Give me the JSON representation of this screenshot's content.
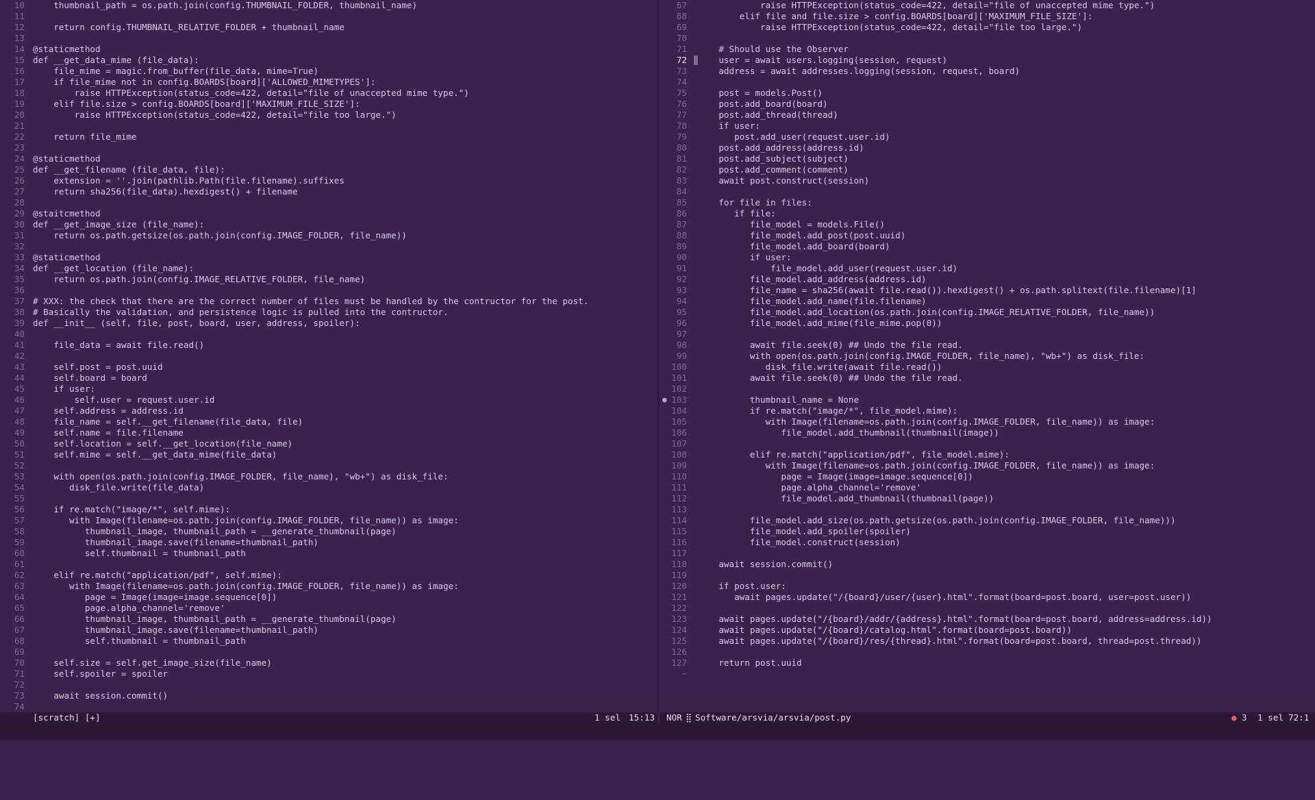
{
  "editor": {
    "left_pane": {
      "lines": [
        {
          "n": "10",
          "code": "    thumbnail_path = os.path.join(config.THUMBNAIL_FOLDER, thumbnail_name)"
        },
        {
          "n": "11",
          "code": ""
        },
        {
          "n": "12",
          "code": "    return config.THUMBNAIL_RELATIVE_FOLDER + thumbnail_name"
        },
        {
          "n": "13",
          "code": ""
        },
        {
          "n": "14",
          "code": "@staticmethod"
        },
        {
          "n": "15",
          "code": "def __get_data_mime (file_data):"
        },
        {
          "n": "16",
          "code": "    file_mime = magic.from_buffer(file_data, mime=True)"
        },
        {
          "n": "17",
          "code": "    if file_mime not in config.BOARDS[board]['ALLOWED_MIMETYPES']:"
        },
        {
          "n": "18",
          "code": "        raise HTTPException(status_code=422, detail=\"file of unaccepted mime type.\")"
        },
        {
          "n": "19",
          "code": "    elif file.size > config.BOARDS[board]['MAXIMUM_FILE_SIZE']:"
        },
        {
          "n": "20",
          "code": "        raise HTTPException(status_code=422, detail=\"file too large.\")"
        },
        {
          "n": "21",
          "code": ""
        },
        {
          "n": "22",
          "code": "    return file_mime"
        },
        {
          "n": "23",
          "code": ""
        },
        {
          "n": "24",
          "code": "@staticmethod"
        },
        {
          "n": "25",
          "code": "def __get_filename (file_data, file):"
        },
        {
          "n": "26",
          "code": "    extension = ''.join(pathlib.Path(file.filename).suffixes"
        },
        {
          "n": "27",
          "code": "    return sha256(file_data).hexdigest() + filename"
        },
        {
          "n": "28",
          "code": ""
        },
        {
          "n": "29",
          "code": "@staitcmethod"
        },
        {
          "n": "30",
          "code": "def __get_image_size (file_name):"
        },
        {
          "n": "31",
          "code": "    return os.path.getsize(os.path.join(config.IMAGE_FOLDER, file_name))"
        },
        {
          "n": "32",
          "code": ""
        },
        {
          "n": "33",
          "code": "@staticmethod"
        },
        {
          "n": "34",
          "code": "def __get_location (file_name):"
        },
        {
          "n": "35",
          "code": "    return os.path.join(config.IMAGE_RELATIVE_FOLDER, file_name)"
        },
        {
          "n": "36",
          "code": ""
        },
        {
          "n": "37",
          "code": "# XXX: the check that there are the correct number of files must be handled by the contructor for the post."
        },
        {
          "n": "38",
          "code": "# Basically the validation, and persistence logic is pulled into the contructor."
        },
        {
          "n": "39",
          "code": "def __init__ (self, file, post, board, user, address, spoiler):"
        },
        {
          "n": "40",
          "code": ""
        },
        {
          "n": "41",
          "code": "    file_data = await file.read()"
        },
        {
          "n": "42",
          "code": ""
        },
        {
          "n": "43",
          "code": "    self.post = post.uuid"
        },
        {
          "n": "44",
          "code": "    self.board = board"
        },
        {
          "n": "45",
          "code": "    if user:"
        },
        {
          "n": "46",
          "code": "        self.user = request.user.id"
        },
        {
          "n": "47",
          "code": "    self.address = address.id"
        },
        {
          "n": "48",
          "code": "    file_name = self.__get_filename(file_data, file)"
        },
        {
          "n": "49",
          "code": "    self.name = file.filename"
        },
        {
          "n": "50",
          "code": "    self.location = self.__get_location(file_name)"
        },
        {
          "n": "51",
          "code": "    self.mime = self.__get_data_mime(file_data)"
        },
        {
          "n": "52",
          "code": ""
        },
        {
          "n": "53",
          "code": "    with open(os.path.join(config.IMAGE_FOLDER, file_name), \"wb+\") as disk_file:"
        },
        {
          "n": "54",
          "code": "       disk_file.write(file_data)"
        },
        {
          "n": "55",
          "code": ""
        },
        {
          "n": "56",
          "code": "    if re.match(\"image/*\", self.mime):"
        },
        {
          "n": "57",
          "code": "       with Image(filename=os.path.join(config.IMAGE_FOLDER, file_name)) as image:"
        },
        {
          "n": "58",
          "code": "          thumbnail_image, thumbnail_path = __generate_thumbnail(page)"
        },
        {
          "n": "59",
          "code": "          thumbnail_image.save(filename=thumbnail_path)"
        },
        {
          "n": "60",
          "code": "          self.thumbnail = thumbnail_path"
        },
        {
          "n": "61",
          "code": ""
        },
        {
          "n": "62",
          "code": "    elif re.match(\"application/pdf\", self.mime):"
        },
        {
          "n": "63",
          "code": "       with Image(filename=os.path.join(config.IMAGE_FOLDER, file_name)) as image:"
        },
        {
          "n": "64",
          "code": "          page = Image(image=image.sequence[0])"
        },
        {
          "n": "65",
          "code": "          page.alpha_channel='remove'"
        },
        {
          "n": "66",
          "code": "          thumbnail_image, thumbnail_path = __generate_thumbnail(page)"
        },
        {
          "n": "67",
          "code": "          thumbnail_image.save(filename=thumbnail_path)"
        },
        {
          "n": "68",
          "code": "          self.thumbnail = thumbnail_path"
        },
        {
          "n": "69",
          "code": ""
        },
        {
          "n": "70",
          "code": "    self.size = self.get_image_size(file_name)"
        },
        {
          "n": "71",
          "code": "    self.spoiler = spoiler"
        },
        {
          "n": "72",
          "code": ""
        },
        {
          "n": "73",
          "code": "    await session.commit()"
        },
        {
          "n": "74",
          "code": ""
        }
      ]
    },
    "right_pane": {
      "lines": [
        {
          "n": "67",
          "code": "            raise HTTPException(status_code=422, detail=\"file of unaccepted mime type.\")"
        },
        {
          "n": "68",
          "code": "        elif file and file.size > config.BOARDS[board]['MAXIMUM_FILE_SIZE']:"
        },
        {
          "n": "69",
          "code": "            raise HTTPException(status_code=422, detail=\"file too large.\")"
        },
        {
          "n": "70",
          "code": ""
        },
        {
          "n": "71",
          "code": "    # Should use the Observer"
        },
        {
          "n": "72",
          "code": "    user = await users.logging(session, request)"
        },
        {
          "n": "73",
          "code": "    address = await addresses.logging(session, request, board)"
        },
        {
          "n": "74",
          "code": ""
        },
        {
          "n": "75",
          "code": "    post = models.Post()"
        },
        {
          "n": "76",
          "code": "    post.add_board(board)"
        },
        {
          "n": "77",
          "code": "    post.add_thread(thread)"
        },
        {
          "n": "78",
          "code": "    if user:"
        },
        {
          "n": "79",
          "code": "       post.add_user(request.user.id)"
        },
        {
          "n": "80",
          "code": "    post.add_address(address.id)"
        },
        {
          "n": "81",
          "code": "    post.add_subject(subject)"
        },
        {
          "n": "82",
          "code": "    post.add_comment(comment)"
        },
        {
          "n": "83",
          "code": "    await post.construct(session)"
        },
        {
          "n": "84",
          "code": ""
        },
        {
          "n": "85",
          "code": "    for file in files:"
        },
        {
          "n": "86",
          "code": "       if file:"
        },
        {
          "n": "87",
          "code": "          file_model = models.File()"
        },
        {
          "n": "88",
          "code": "          file_model.add_post(post.uuid)"
        },
        {
          "n": "89",
          "code": "          file_model.add_board(board)"
        },
        {
          "n": "90",
          "code": "          if user:"
        },
        {
          "n": "91",
          "code": "              file_model.add_user(request.user.id)"
        },
        {
          "n": "92",
          "code": "          file_model.add_address(address.id)"
        },
        {
          "n": "93",
          "code": "          file_name = sha256(await file.read()).hexdigest() + os.path.splitext(file.filename)[1]"
        },
        {
          "n": "94",
          "code": "          file_model.add_name(file.filename)"
        },
        {
          "n": "95",
          "code": "          file_model.add_location(os.path.join(config.IMAGE_RELATIVE_FOLDER, file_name))"
        },
        {
          "n": "96",
          "code": "          file_model.add_mime(file_mime.pop(0))"
        },
        {
          "n": "97",
          "code": ""
        },
        {
          "n": "98",
          "code": "          await file.seek(0) ## Undo the file read."
        },
        {
          "n": "99",
          "code": "          with open(os.path.join(config.IMAGE_FOLDER, file_name), \"wb+\") as disk_file:"
        },
        {
          "n": "100",
          "code": "             disk_file.write(await file.read())"
        },
        {
          "n": "101",
          "code": "          await file.seek(0) ## Undo the file read."
        },
        {
          "n": "102",
          "code": ""
        },
        {
          "n": "103",
          "code": "          thumbnail_name = None"
        },
        {
          "n": "104",
          "code": "          if re.match(\"image/*\", file_model.mime):"
        },
        {
          "n": "105",
          "code": "             with Image(filename=os.path.join(config.IMAGE_FOLDER, file_name)) as image:"
        },
        {
          "n": "106",
          "code": "                file_model.add_thumbnail(thumbnail(image))"
        },
        {
          "n": "107",
          "code": ""
        },
        {
          "n": "108",
          "code": "          elif re.match(\"application/pdf\", file_model.mime):"
        },
        {
          "n": "109",
          "code": "             with Image(filename=os.path.join(config.IMAGE_FOLDER, file_name)) as image:"
        },
        {
          "n": "110",
          "code": "                page = Image(image=image.sequence[0])"
        },
        {
          "n": "111",
          "code": "                page.alpha_channel='remove'"
        },
        {
          "n": "112",
          "code": "                file_model.add_thumbnail(thumbnail(page))"
        },
        {
          "n": "113",
          "code": ""
        },
        {
          "n": "114",
          "code": "          file_model.add_size(os.path.getsize(os.path.join(config.IMAGE_FOLDER, file_name)))"
        },
        {
          "n": "115",
          "code": "          file_model.add_spoiler(spoiler)"
        },
        {
          "n": "116",
          "code": "          file_model.construct(session)"
        },
        {
          "n": "117",
          "code": ""
        },
        {
          "n": "118",
          "code": "    await session.commit()"
        },
        {
          "n": "119",
          "code": ""
        },
        {
          "n": "120",
          "code": "    if post.user:"
        },
        {
          "n": "121",
          "code": "       await pages.update(\"/{board}/user/{user}.html\".format(board=post.board, user=post.user))"
        },
        {
          "n": "122",
          "code": ""
        },
        {
          "n": "123",
          "code": "    await pages.update(\"/{board}/addr/{address}.html\".format(board=post.board, address=address.id))"
        },
        {
          "n": "124",
          "code": "    await pages.update(\"/{board}/catalog.html\".format(board=post.board))"
        },
        {
          "n": "125",
          "code": "    await pages.update(\"/{board}/res/{thread}.html\".format(board=post.board, thread=post.thread))"
        },
        {
          "n": "126",
          "code": ""
        },
        {
          "n": "127",
          "code": "    return post.uuid"
        }
      ],
      "end_marker": "~"
    }
  },
  "status_left": {
    "buffer": "[scratch] [+]",
    "selection": "1 sel",
    "position": "15:13"
  },
  "status_right": {
    "mode": "NOR",
    "separator": "⣿",
    "file": "Software/arsvia/arsvia/post.py",
    "diagnostics_dot": "●",
    "diagnostics_count": "3",
    "selection": "1 sel",
    "position": "72:1"
  },
  "colors": {
    "background": "#3b224c",
    "statusbar": "#2b1838",
    "gutter": "#7f6a93",
    "error": "#e8596a"
  }
}
